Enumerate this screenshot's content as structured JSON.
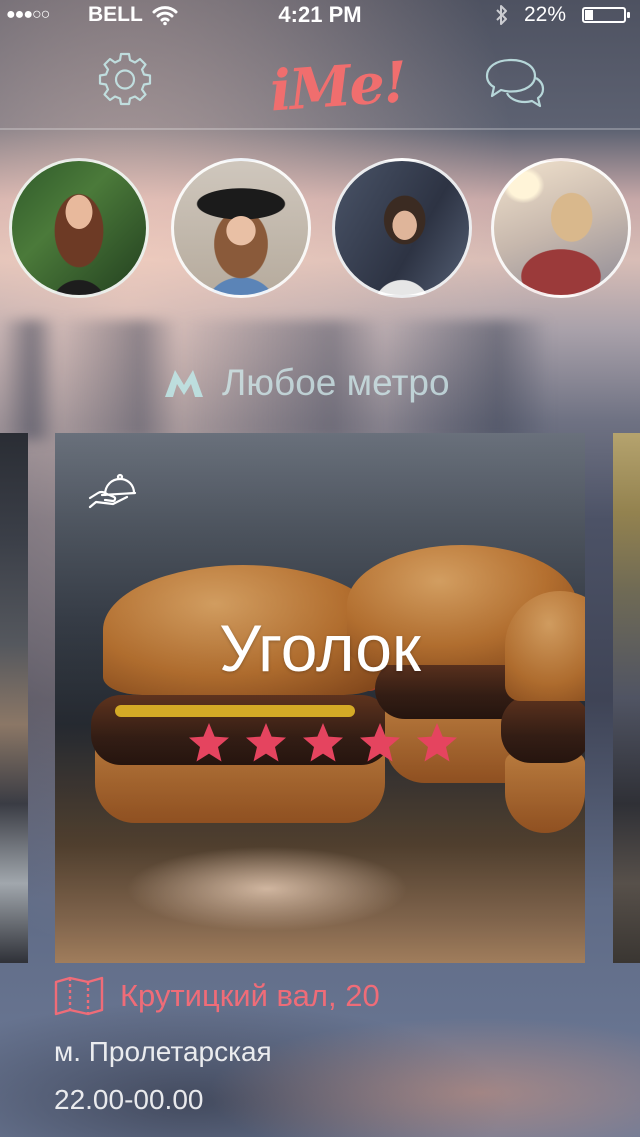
{
  "status_bar": {
    "signal": "●●●○○",
    "carrier": "BELL",
    "time": "4:21 PM",
    "battery_percent": "22%",
    "battery_level": 0.22,
    "icons": [
      "wifi-icon",
      "bluetooth-icon",
      "battery-icon"
    ]
  },
  "nav": {
    "logo": "iMe!",
    "left_icon": "gear-icon",
    "right_icon": "chat-bubbles-icon",
    "accent_color": "#f06e6e"
  },
  "avatars": [
    {
      "name": "profile-1"
    },
    {
      "name": "profile-2"
    },
    {
      "name": "profile-3"
    },
    {
      "name": "profile-4"
    }
  ],
  "metro_filter": {
    "icon": "metro-icon",
    "label": "Любое метро"
  },
  "venue_card": {
    "icon": "waiter-cloche-icon",
    "title": "Уголок",
    "rating": 5,
    "rating_max": 5,
    "star_color": "#e5445f"
  },
  "venue_info": {
    "map_icon": "map-icon",
    "address": "Крутицкий вал, 20",
    "station": "м. Пролетарская",
    "hours": "22.00-00.00",
    "address_color": "#ef6c78"
  }
}
